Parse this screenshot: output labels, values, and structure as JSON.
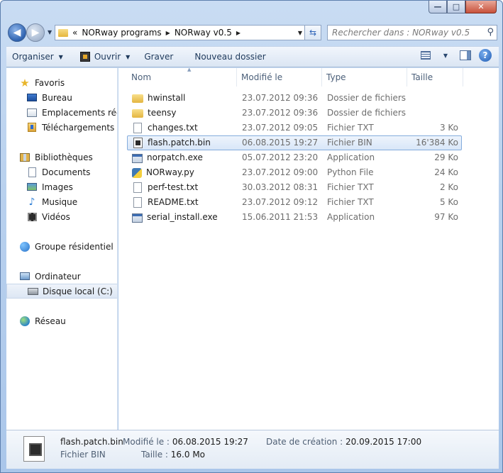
{
  "window": {
    "minimize_label": "—",
    "maximize_label": "□",
    "close_label": "✕"
  },
  "address": {
    "overflow": "«",
    "crumbs": [
      "NORway programs",
      "NORway v0.5"
    ]
  },
  "search": {
    "placeholder": "Rechercher dans : NORway v0.5"
  },
  "toolbar": {
    "organize": "Organiser",
    "open": "Ouvrir",
    "burn": "Graver",
    "new_folder": "Nouveau dossier"
  },
  "sidebar": {
    "favorites": "Favoris",
    "desktop": "Bureau",
    "recent": "Emplacements récer",
    "downloads": "Téléchargements",
    "libraries": "Bibliothèques",
    "documents": "Documents",
    "images": "Images",
    "music": "Musique",
    "videos": "Vidéos",
    "homegroup": "Groupe résidentiel",
    "computer": "Ordinateur",
    "local_disk": "Disque local (C:)",
    "network": "Réseau"
  },
  "columns": {
    "name": "Nom",
    "modified": "Modifié le",
    "type": "Type",
    "size": "Taille"
  },
  "files": [
    {
      "name": "hwinstall",
      "date": "23.07.2012 09:36",
      "type": "Dossier de fichiers",
      "size": "",
      "icon": "folder-icon"
    },
    {
      "name": "teensy",
      "date": "23.07.2012 09:36",
      "type": "Dossier de fichiers",
      "size": "",
      "icon": "folder-icon"
    },
    {
      "name": "changes.txt",
      "date": "23.07.2012 09:05",
      "type": "Fichier TXT",
      "size": "3 Ko",
      "icon": "text-file-icon"
    },
    {
      "name": "flash.patch.bin",
      "date": "06.08.2015 19:27",
      "type": "Fichier BIN",
      "size": "16'384 Ko",
      "icon": "bin-file-icon"
    },
    {
      "name": "norpatch.exe",
      "date": "05.07.2012 23:20",
      "type": "Application",
      "size": "29 Ko",
      "icon": "exe-icon"
    },
    {
      "name": "NORway.py",
      "date": "23.07.2012 09:00",
      "type": "Python File",
      "size": "24 Ko",
      "icon": "python-file-icon"
    },
    {
      "name": "perf-test.txt",
      "date": "30.03.2012 08:31",
      "type": "Fichier TXT",
      "size": "2 Ko",
      "icon": "text-file-icon"
    },
    {
      "name": "README.txt",
      "date": "23.07.2012 09:12",
      "type": "Fichier TXT",
      "size": "5 Ko",
      "icon": "text-file-icon"
    },
    {
      "name": "serial_install.exe",
      "date": "15.06.2011 21:53",
      "type": "Application",
      "size": "97 Ko",
      "icon": "exe-icon"
    }
  ],
  "selected_file": "flash.patch.bin",
  "details": {
    "name": "flash.patch.bin",
    "type": "Fichier BIN",
    "modified_label": "Modifié le :",
    "modified_value": "06.08.2015 19:27",
    "size_label": "Taille :",
    "size_value": "16.0 Mo",
    "created_label": "Date de création :",
    "created_value": "20.09.2015 17:00"
  }
}
